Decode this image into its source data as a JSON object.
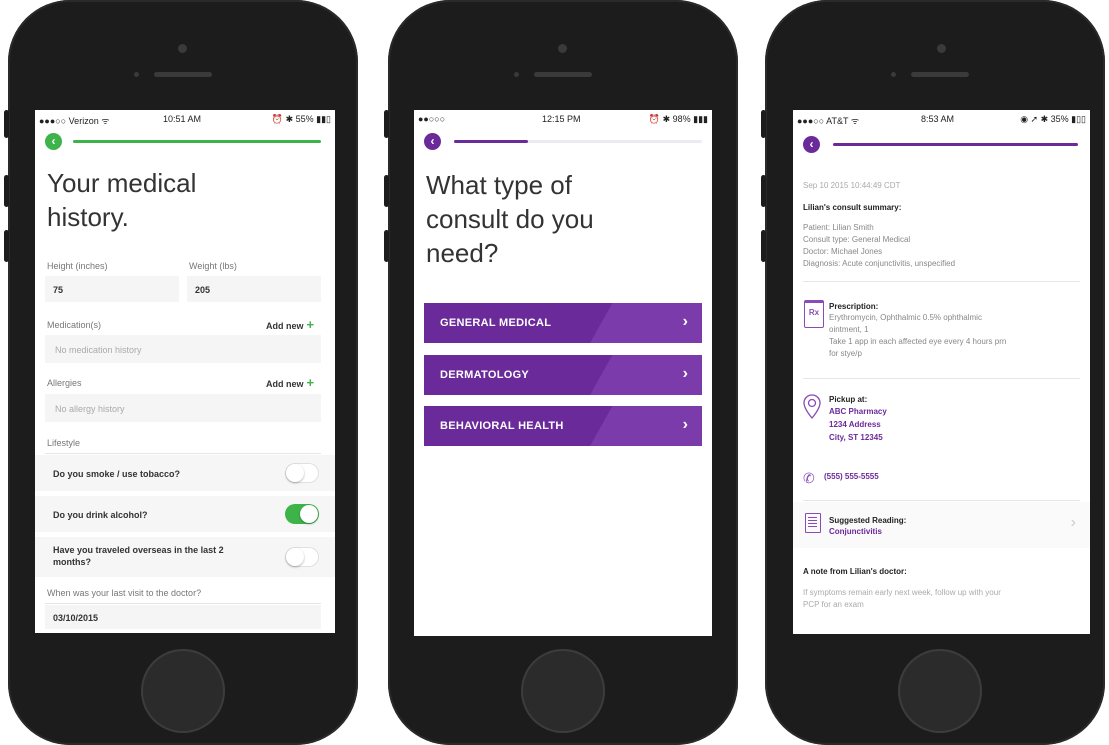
{
  "phone1": {
    "status": {
      "carrier": "●●●○○ Verizon ᯤ",
      "time": "10:51 AM",
      "battery": "⏰ ✱ 55% ▮▮▯"
    },
    "accent": "#3db34a",
    "title": "Your medical\nhistory.",
    "height_label": "Height (inches)",
    "height_value": "75",
    "weight_label": "Weight (lbs)",
    "weight_value": "205",
    "medication_label": "Medication(s)",
    "medication_add": "Add new",
    "medication_placeholder": "No medication history",
    "allergies_label": "Allergies",
    "allergies_add": "Add new",
    "allergies_placeholder": "No allergy history",
    "lifestyle_label": "Lifestyle",
    "q_smoke": "Do you smoke / use tobacco?",
    "q_alcohol": "Do you drink alcohol?",
    "q_travel": "Have you traveled overseas in the last 2 months?",
    "toggle_states": {
      "smoke": false,
      "alcohol": true,
      "travel": false
    },
    "visit_label": "When was your last visit to the doctor?",
    "visit_value": "03/10/2015",
    "progress": 1.0
  },
  "phone2": {
    "status": {
      "carrier": "●●○○○",
      "time": "12:15 PM",
      "battery": "⏰ ✱ 98% ▮▮▮"
    },
    "accent": "#6b2a9a",
    "title": "What type of\nconsult do you\nneed?",
    "progress": 0.3,
    "options": [
      {
        "label": "GENERAL MEDICAL"
      },
      {
        "label": "DERMATOLOGY"
      },
      {
        "label": "BEHAVIORAL HEALTH"
      }
    ]
  },
  "phone3": {
    "status": {
      "carrier": "●●●○○ AT&T ᯤ",
      "time": "8:53 AM",
      "battery": "◉ ➚ ✱ 35% ▮▯▯"
    },
    "accent": "#6b2a9a",
    "progress": 1.0,
    "date": "Sep 10 2015 10:44:49 CDT",
    "summary_title": "Lilian's consult summary:",
    "patient": "Patient: Lilian Smith",
    "consult_type": "Consult type: General Medical",
    "doctor": "Doctor: Michael Jones",
    "diagnosis": "Diagnosis: Acute conjunctivitis, unspecified",
    "rx_title": "Prescription:",
    "rx_line1": "Erythromycin, Ophthalmic 0.5% ophthalmic",
    "rx_line2": "ointment, 1",
    "rx_line3": "Take 1 app in each affected eye every 4 hours prn",
    "rx_line4": "for stye/p",
    "rx_icon": "Rx",
    "pickup_title": "Pickup at:",
    "pharmacy": "ABC Pharmacy",
    "address": "1234 Address",
    "city": "City, ST 12345",
    "phone": "(555) 555-5555",
    "reading_title": "Suggested Reading:",
    "reading_link": "Conjunctivitis",
    "note_title": "A note from Lilian's doctor:",
    "note_line1": "If symptoms remain early next week, follow up with your",
    "note_line2": "PCP for an exam"
  }
}
